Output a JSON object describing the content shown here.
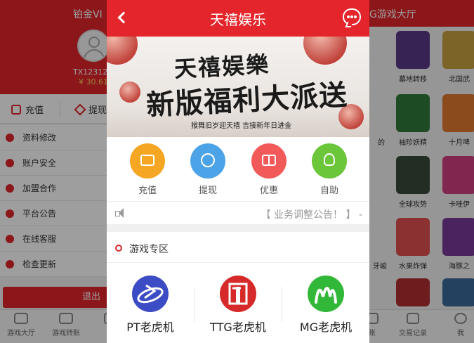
{
  "left": {
    "title": "铂金VI",
    "user": "TX12312",
    "balance": "¥ 30.61",
    "recharge": "充值",
    "withdraw": "提现",
    "menu": [
      "资料修改",
      "账户安全",
      "加盟合作",
      "平台公告",
      "在线客服",
      "检查更新"
    ],
    "logout": "退出",
    "tabs": [
      "游戏大厅",
      "游戏转账",
      "交"
    ]
  },
  "right": {
    "title": "G游戏大厅",
    "games": [
      "墓地转移",
      "北国武",
      "袖珍妖精",
      "十月啤",
      "全球攻势",
      "卡哇伊",
      "水果炸弹",
      "海豚之",
      "牙峻",
      "的"
    ],
    "tabs": [
      "交易记录",
      "我",
      "账"
    ]
  },
  "header": {
    "back_icon": "chevron-left-icon",
    "title": "天禧娱乐",
    "chat_icon": "chat-bubble-icon"
  },
  "banner": {
    "calligraphy_top": "天禧娱樂",
    "calligraphy_main": "新版福利大派送",
    "subtitle": "猴舞旧岁迎天禧 吉接新年日进金"
  },
  "quick_actions": [
    {
      "label": "充值",
      "icon": "wallet-icon",
      "color": "#f5a623"
    },
    {
      "label": "提现",
      "icon": "upload-icon",
      "color": "#4da3e8"
    },
    {
      "label": "优惠",
      "icon": "gift-icon",
      "color": "#f25a5a"
    },
    {
      "label": "自助",
      "icon": "lightbulb-icon",
      "color": "#6cc63a"
    }
  ],
  "notice": {
    "icon": "speaker-icon",
    "text": "【 业务调整公告！ 】 -"
  },
  "game_zone": {
    "title": "游戏专区",
    "games": [
      {
        "name": "PT老虎机",
        "color": "#3b4cc4"
      },
      {
        "name": "TTG老虎机",
        "color": "#d62a2a"
      },
      {
        "name": "MG老虎机",
        "color": "#32b838"
      }
    ]
  },
  "colors": {
    "brand_red": "#e4252b"
  }
}
